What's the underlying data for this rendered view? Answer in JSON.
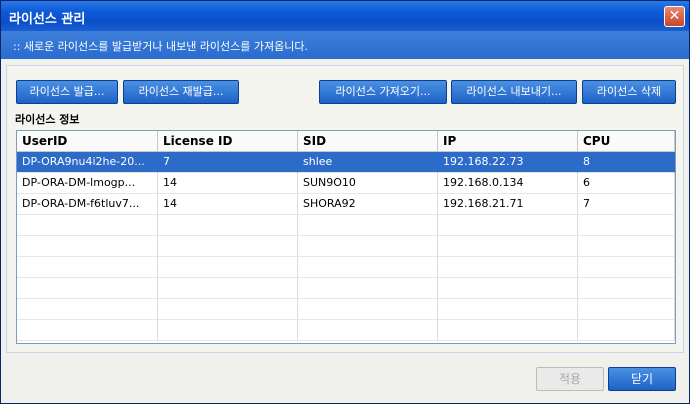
{
  "window": {
    "title": "라이선스 관리",
    "close_glyph": "✕"
  },
  "info": {
    "text": ":: 새로운 라이선스를 발급받거나 내보낸 라이선스를 가져옵니다."
  },
  "toolbar": {
    "issue_label": "라이선스 발급...",
    "reissue_label": "라이선스 재발급...",
    "import_label": "라이선스 가져오기...",
    "export_label": "라이선스 내보내기...",
    "delete_label": "라이선스 삭제"
  },
  "section": {
    "label": "라이선스 정보"
  },
  "table": {
    "columns": [
      "UserID",
      "License ID",
      "SID",
      "IP",
      "CPU"
    ],
    "rows": [
      [
        "DP-ORA9nu4i2he-20...",
        "7",
        "shlee",
        "192.168.22.73",
        "8"
      ],
      [
        "DP-ORA-DM-lmogp...",
        "14",
        "SUN9O10",
        "192.168.0.134",
        "6"
      ],
      [
        "DP-ORA-DM-f6tluv7...",
        "14",
        "SHORA92",
        "192.168.21.71",
        "7"
      ]
    ],
    "selected_row": 0
  },
  "footer": {
    "apply_label": "적용",
    "close_label": "닫기"
  },
  "colors": {
    "titlebar": "#0d5ad8",
    "selection": "#2d6bc8",
    "button": "#1e62c8"
  }
}
